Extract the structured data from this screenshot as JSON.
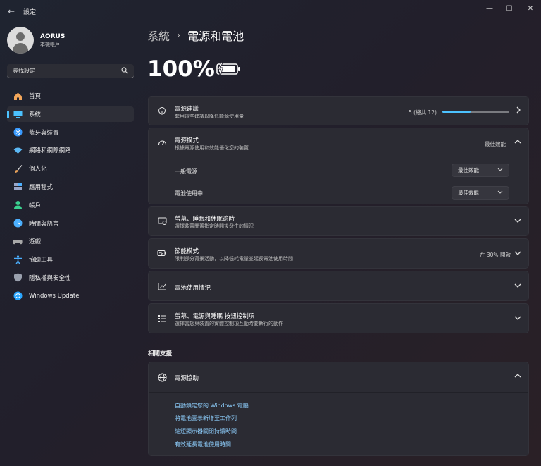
{
  "window": {
    "title": "設定",
    "back_glyph": "←",
    "min_glyph": "—",
    "max_glyph": "☐",
    "close_glyph": "✕"
  },
  "profile": {
    "name": "AORUS",
    "account_type": "本機帳戶"
  },
  "search": {
    "placeholder": "尋找設定",
    "icon": "search-icon"
  },
  "sidebar": {
    "items": [
      {
        "label": "首頁",
        "icon": "home-icon",
        "color": "#f2a65a"
      },
      {
        "label": "系統",
        "icon": "system-icon",
        "color": "#4cc2ff",
        "active": true
      },
      {
        "label": "藍牙與裝置",
        "icon": "bluetooth-icon",
        "color": "#3a9bff"
      },
      {
        "label": "網路和網際網路",
        "icon": "network-icon",
        "color": "#5bb8f5"
      },
      {
        "label": "個人化",
        "icon": "brush-icon",
        "color": "#e6a15a"
      },
      {
        "label": "應用程式",
        "icon": "apps-icon",
        "color": "#9aa7c9"
      },
      {
        "label": "帳戶",
        "icon": "account-icon",
        "color": "#3ad18f"
      },
      {
        "label": "時間與語言",
        "icon": "clock-globe-icon",
        "color": "#4cb0ff"
      },
      {
        "label": "遊戲",
        "icon": "gamepad-icon",
        "color": "#a8a8a8"
      },
      {
        "label": "協助工具",
        "icon": "accessibility-icon",
        "color": "#4cb0ff"
      },
      {
        "label": "隱私權與安全性",
        "icon": "shield-icon",
        "color": "#9aa0ad"
      },
      {
        "label": "Windows Update",
        "icon": "update-icon",
        "color": "#2aa6ff"
      }
    ]
  },
  "breadcrumb": {
    "parent": "系統",
    "separator": "›",
    "current": "電源和電池"
  },
  "battery": {
    "percent_text": "100%",
    "level": 1.0,
    "charging": true
  },
  "cards": {
    "power_recommendations": {
      "title": "電源建議",
      "subtitle": "套用這些建議以降低能源使用量",
      "value": "5 (總共 12)",
      "progress": 0.42
    },
    "power_mode": {
      "title": "電源模式",
      "subtitle": "根據電源使用和效能優化您的裝置",
      "value": "最佳效能",
      "rows": [
        {
          "label": "一般電源",
          "selected": "最佳效能"
        },
        {
          "label": "電池使用中",
          "selected": "最佳效能"
        }
      ]
    },
    "screen_sleep": {
      "title": "螢幕、睡眠和休眠逾時",
      "subtitle": "選擇裝置閒置指定時間後發生的情況"
    },
    "energy_saver": {
      "title": "節能模式",
      "subtitle": "限制部分背景活動，以降低耗電量並延長電池使用時間",
      "value": "在 30% 開啟"
    },
    "battery_usage": {
      "title": "電池使用情況"
    },
    "lid_buttons": {
      "title": "螢幕、電源與睡眠 按鈕控制項",
      "subtitle": "選擇當您與裝置的實體控制項互動時要執行的動作"
    }
  },
  "related_support": {
    "heading": "相關支援",
    "card_title": "電源協助",
    "links": [
      "自動鎖定您的 Windows 電腦",
      "將電池圖示新增至工作列",
      "縮短顯示器關閉持續時間",
      "有效延長電池使用時間"
    ]
  },
  "colors": {
    "accent": "#4cc2ff",
    "card_bg": "#2b2b33",
    "link": "#8fd0ff"
  }
}
